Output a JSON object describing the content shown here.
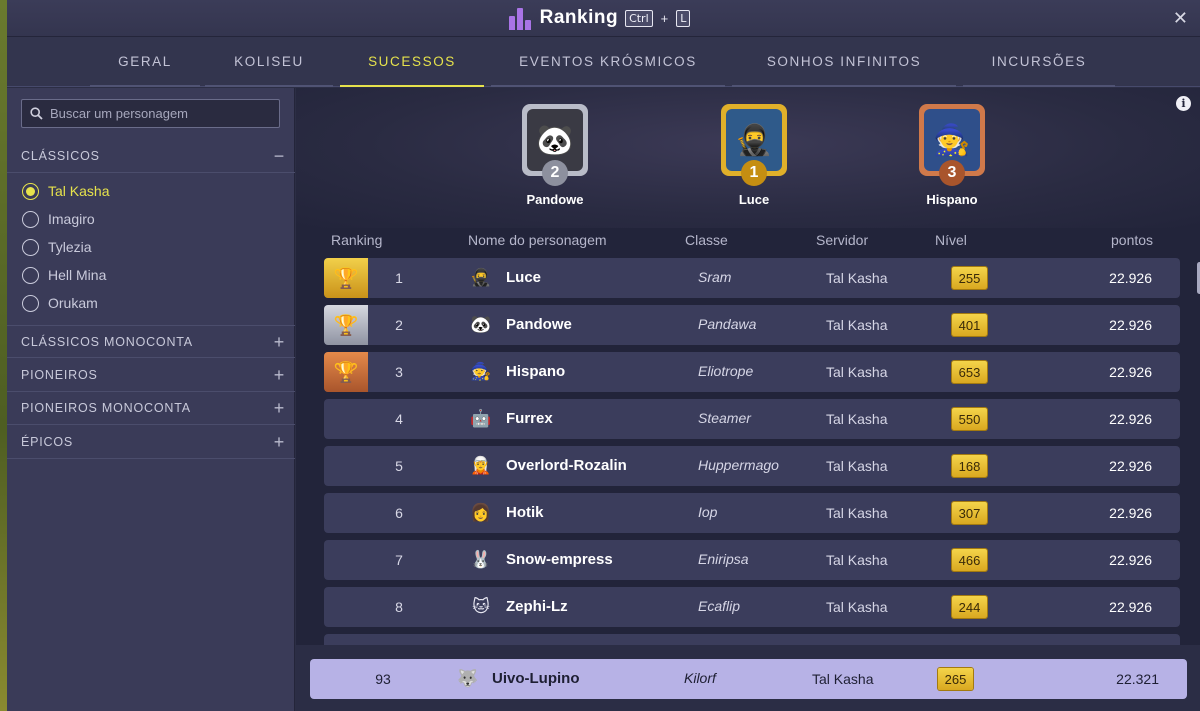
{
  "window": {
    "title": "Ranking",
    "shortcut_key1": "Ctrl",
    "shortcut_plus": "+",
    "shortcut_key2": "L",
    "close_icon": "close-icon"
  },
  "tabs": [
    {
      "label": "GERAL"
    },
    {
      "label": "KOLISEU"
    },
    {
      "label": "SUCESSOS",
      "active": true
    },
    {
      "label": "EVENTOS KRÓSMICOS"
    },
    {
      "label": "SONHOS INFINITOS"
    },
    {
      "label": "INCURSÕES"
    }
  ],
  "sidebar": {
    "search_placeholder": "Buscar um personagem",
    "sections": [
      {
        "label": "CLÁSSICOS",
        "toggle": "−",
        "expanded": true
      },
      {
        "label": "CLÁSSICOS MONOCONTA",
        "toggle": "+"
      },
      {
        "label": "PIONEIROS",
        "toggle": "+"
      },
      {
        "label": "PIONEIROS MONOCONTA",
        "toggle": "+"
      },
      {
        "label": "ÉPICOS",
        "toggle": "+"
      }
    ],
    "servers": [
      {
        "label": "Tal Kasha",
        "selected": true
      },
      {
        "label": "Imagiro"
      },
      {
        "label": "Tylezia"
      },
      {
        "label": "Hell Mina"
      },
      {
        "label": "Orukam"
      }
    ]
  },
  "podium": [
    {
      "place": "2",
      "name": "Pandowe",
      "color": "#b9bcc8"
    },
    {
      "place": "1",
      "name": "Luce",
      "color": "#e0b02a"
    },
    {
      "place": "3",
      "name": "Hispano",
      "color": "#d0794a"
    }
  ],
  "table": {
    "headers": {
      "ranking": "Ranking",
      "name": "Nome do personagem",
      "class": "Classe",
      "server": "Servidor",
      "level": "Nível",
      "points": "pontos"
    },
    "rows": [
      {
        "rank": "1",
        "name": "Luce",
        "class": "Sram",
        "server": "Tal Kasha",
        "level": "255",
        "points": "22.926",
        "cup": "gold"
      },
      {
        "rank": "2",
        "name": "Pandowe",
        "class": "Pandawa",
        "server": "Tal Kasha",
        "level": "401",
        "points": "22.926",
        "cup": "silver"
      },
      {
        "rank": "3",
        "name": "Hispano",
        "class": "Eliotrope",
        "server": "Tal Kasha",
        "level": "653",
        "points": "22.926",
        "cup": "bronze"
      },
      {
        "rank": "4",
        "name": "Furrex",
        "class": "Steamer",
        "server": "Tal Kasha",
        "level": "550",
        "points": "22.926"
      },
      {
        "rank": "5",
        "name": "Overlord-Rozalin",
        "class": "Huppermago",
        "server": "Tal Kasha",
        "level": "168",
        "points": "22.926"
      },
      {
        "rank": "6",
        "name": "Hotik",
        "class": "Iop",
        "server": "Tal Kasha",
        "level": "307",
        "points": "22.926"
      },
      {
        "rank": "7",
        "name": "Snow-empress",
        "class": "Eniripsa",
        "server": "Tal Kasha",
        "level": "466",
        "points": "22.926"
      },
      {
        "rank": "8",
        "name": "Zephi-Lz",
        "class": "Ecaflip",
        "server": "Tal Kasha",
        "level": "244",
        "points": "22.926"
      }
    ],
    "own": {
      "rank": "93",
      "name": "Uivo-Lupino",
      "class": "Kilorf",
      "server": "Tal Kasha",
      "level": "265",
      "points": "22.321"
    }
  },
  "colors": {
    "accent": "#e6e24c",
    "gold": "#e0b02a",
    "silver": "#b9bcc8",
    "bronze": "#d0794a",
    "own_row": "#b7b2e6"
  }
}
